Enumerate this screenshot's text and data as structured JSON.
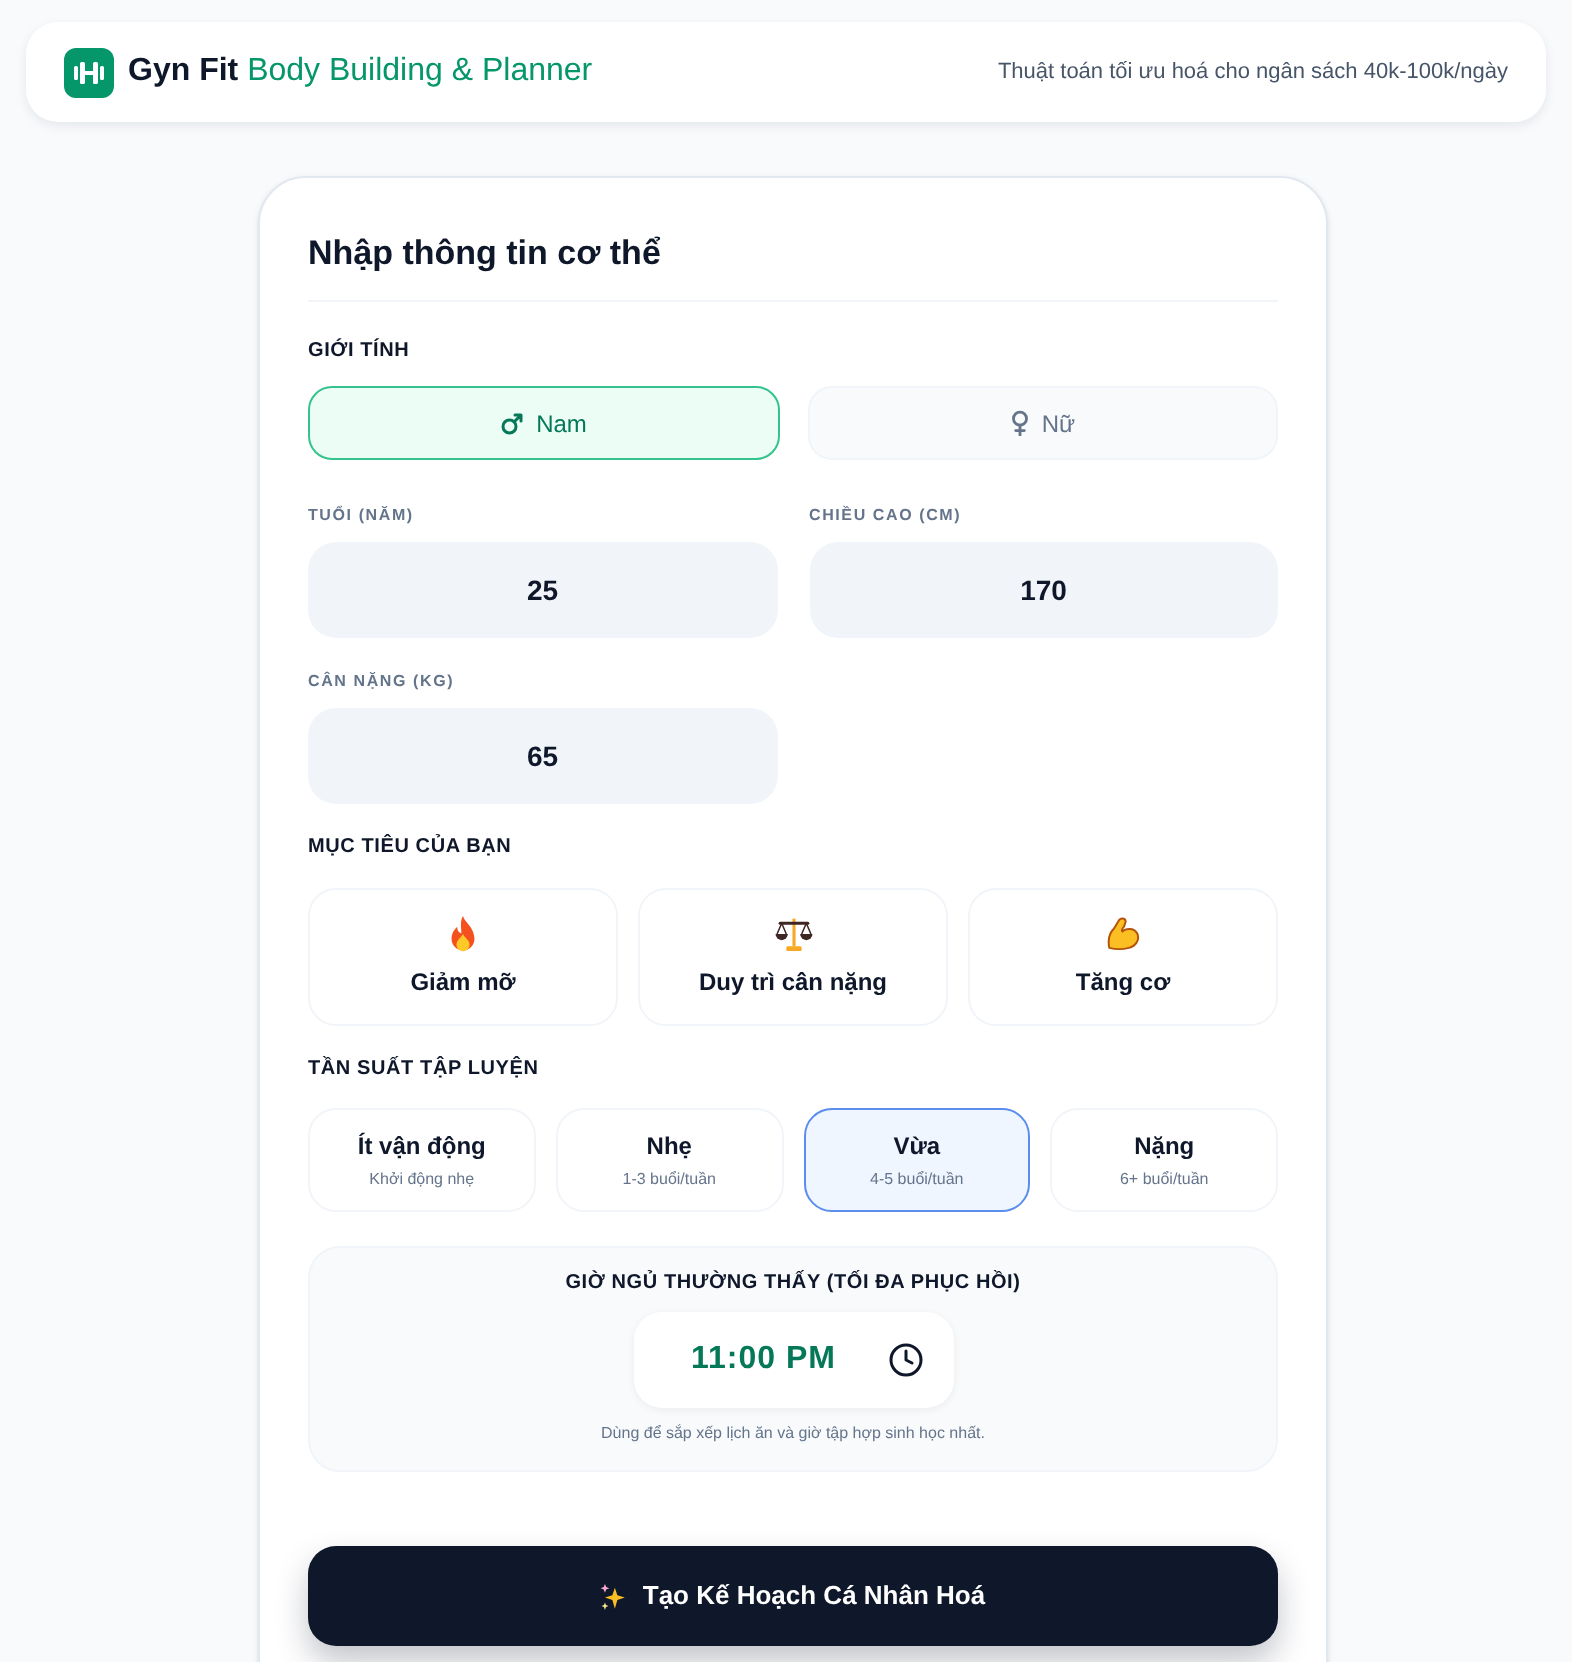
{
  "header": {
    "title": "Gyn Fit",
    "subtitle": "Body Building & Planner",
    "tagline": "Thuật toán tối ưu hoá cho ngân sách 40k-100k/ngày"
  },
  "form": {
    "title": "Nhập thông tin cơ thể",
    "gender": {
      "label": "GIỚI TÍNH",
      "options": [
        {
          "kind": "male",
          "label": "Nam",
          "selected": true
        },
        {
          "kind": "female",
          "label": "Nữ",
          "selected": false
        }
      ]
    },
    "fields": [
      {
        "label": "TUỔI (NĂM)",
        "value": "25"
      },
      {
        "label": "CHIỀU CAO (CM)",
        "value": "170"
      },
      {
        "label": "CÂN NẶNG (KG)",
        "value": "65"
      }
    ],
    "goal": {
      "label": "MỤC TIÊU CỦA BẠN",
      "options": [
        {
          "kind": "fire",
          "label": "Giảm mỡ",
          "selected": false
        },
        {
          "kind": "scales",
          "label": "Duy trì cân nặng",
          "selected": false
        },
        {
          "kind": "arm",
          "label": "Tăng cơ",
          "selected": false
        }
      ]
    },
    "frequency": {
      "label": "TẦN SUẤT TẬP LUYỆN",
      "options": [
        {
          "label": "Ít vận động",
          "detail": "Khởi động nhẹ",
          "selected": false
        },
        {
          "label": "Nhẹ",
          "detail": "1-3 buổi/tuần",
          "selected": false
        },
        {
          "label": "Vừa",
          "detail": "4-5 buổi/tuần",
          "selected": true
        },
        {
          "label": "Nặng",
          "detail": "6+ buổi/tuần",
          "selected": false
        }
      ]
    },
    "sleep": {
      "label": "GIỜ NGỦ THƯỜNG THẤY (TỐI ĐA PHỤC HỒI)",
      "value": "11:00 PM",
      "hint": "Dùng để sắp xếp lịch ăn và giờ tập hợp sinh học nhất."
    },
    "submit": {
      "label": "Tạo Kế Hoạch Cá Nhân Hoá"
    }
  }
}
